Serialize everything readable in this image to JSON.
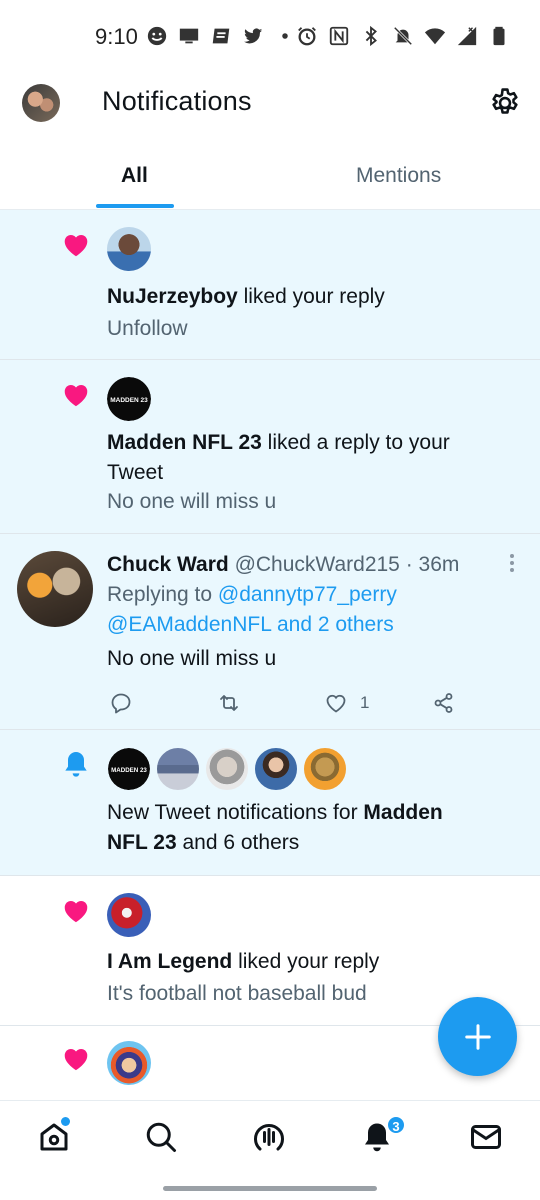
{
  "status_bar": {
    "time": "9:10",
    "left_icons": [
      "smiley-icon",
      "monitor-icon",
      "news-icon",
      "twitter-bird-icon",
      "dot-icon"
    ],
    "right_icons": [
      "alarm-icon",
      "nfc-icon",
      "bluetooth-icon",
      "bell-off-icon",
      "wifi-icon",
      "signal-icon",
      "battery-icon"
    ]
  },
  "header": {
    "title": "Notifications",
    "avatar": "profile-avatar",
    "settings_icon": "gear-icon"
  },
  "tabs": [
    {
      "label": "All",
      "active": true
    },
    {
      "label": "Mentions",
      "active": false
    }
  ],
  "notifications": [
    {
      "type": "like",
      "user": "NuJerzeyboy",
      "action": "liked your reply",
      "detail": "Unfollow",
      "unread": true
    },
    {
      "type": "like",
      "user": "Madden NFL 23",
      "action": "liked a reply to your Tweet",
      "action_line1": "liked a reply to your",
      "action_line2": "Tweet",
      "detail": "No one will miss u",
      "avatar_text": "MADDEN 23",
      "unread": true
    },
    {
      "type": "reply",
      "name": "Chuck Ward",
      "handle": "@ChuckWard215",
      "time": "· 36m",
      "replying_prefix": "Replying to",
      "replying_user1": "@dannytp77_perry",
      "replying_user2": "@EAMaddenNFL",
      "replying_suffix": "and 2 others",
      "text": "No one will miss u",
      "like_count": "1",
      "unread": true
    },
    {
      "type": "new_tweets",
      "prefix": "New Tweet notifications for",
      "bold": "Madden NFL 23",
      "bold_line1": "Madden",
      "bold_line2": "NFL 23",
      "suffix": "and 6 others",
      "avatar_text": "MADDEN 23",
      "unread": true
    },
    {
      "type": "like",
      "user": "I Am Legend",
      "action": "liked your reply",
      "detail": "It's football not baseball bud",
      "unread": false
    },
    {
      "type": "like",
      "unread": false
    }
  ],
  "bottom_nav": {
    "items": [
      "home-icon",
      "search-icon",
      "spaces-icon",
      "notifications-icon",
      "messages-icon"
    ],
    "notifications_badge": "3"
  },
  "colors": {
    "accent": "#1d9bf0",
    "heart": "#f91880",
    "unread_bg": "#eaf8fe",
    "secondary_text": "#536471"
  }
}
